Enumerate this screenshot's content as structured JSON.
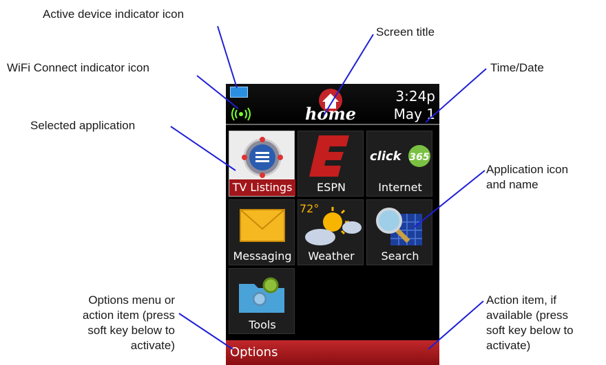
{
  "callouts": {
    "active_device": "Active device indicator icon",
    "wifi": "WiFi Connect indicator icon",
    "selected_app": "Selected application",
    "screen_title": "Screen title",
    "time_date": "Time/Date",
    "app_icon": "Application icon\nand name",
    "options_menu": "Options menu or\naction item (press\nsoft key below to\nactivate)",
    "action_item": "Action item, if\navailable (press\nsoft key below to\nactivate)"
  },
  "status": {
    "time": "3:24p",
    "date": "May 1",
    "logo_text": "home",
    "device_icon": "active-device-icon",
    "wifi_icon": "wifi-connected-icon"
  },
  "apps": [
    {
      "label": "TV Listings",
      "icon": "tv-listings-icon",
      "selected": true
    },
    {
      "label": "ESPN",
      "icon": "espn-icon",
      "selected": false
    },
    {
      "label": "Internet",
      "icon": "click365-internet-icon",
      "selected": false,
      "logo_text": "click 365"
    },
    {
      "label": "Messaging",
      "icon": "envelope-icon",
      "selected": false
    },
    {
      "label": "Weather",
      "icon": "weather-icon",
      "selected": false,
      "temp": "72°"
    },
    {
      "label": "Search",
      "icon": "magnifier-icon",
      "selected": false
    },
    {
      "label": "Tools",
      "icon": "tools-folder-icon",
      "selected": false
    }
  ],
  "softkey": {
    "left_label": "Options"
  },
  "colors": {
    "softbar": "#a0161a",
    "selected_label": "#a0161a",
    "leader_line": "#1f1fd6"
  }
}
